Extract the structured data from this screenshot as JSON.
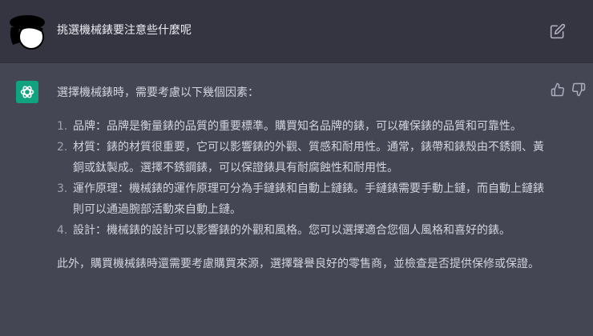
{
  "user_message": {
    "text": "挑選機械錶要注意些什麼呢"
  },
  "assistant_message": {
    "intro": "選擇機械錶時，需要考慮以下幾個因素：",
    "items": [
      {
        "number": "1.",
        "text": "品牌：品牌是衡量錶的品質的重要標準。購買知名品牌的錶，可以確保錶的品質和可靠性。"
      },
      {
        "number": "2.",
        "text": "材質：錶的材質很重要，它可以影響錶的外觀、質感和耐用性。通常，錶帶和錶殼由不銹鋼、黃銅或鈦製成。選擇不銹鋼錶，可以保證錶具有耐腐蝕性和耐用性。"
      },
      {
        "number": "3.",
        "text": "運作原理：機械錶的運作原理可分為手鏈錶和自動上鏈錶。手鏈錶需要手動上鏈，而自動上鏈錶則可以通過腕部活動來自動上鏈。"
      },
      {
        "number": "4.",
        "text": "設計：機械錶的設計可以影響錶的外觀和風格。您可以選擇適合您個人風格和喜好的錶。"
      }
    ],
    "outro": "此外，購買機械錶時還需要考慮購買來源，選擇聲譽良好的零售商，並檢查是否提供保修或保證。"
  },
  "colors": {
    "user_bg": "#343541",
    "assistant_bg": "#444654",
    "accent": "#10a37f",
    "text": "#d1d5db"
  },
  "icons": {
    "user_avatar": "user-avatar-icon",
    "edit": "edit-icon",
    "assistant_logo": "openai-logo-icon",
    "thumbs_up": "thumbs-up-icon",
    "thumbs_down": "thumbs-down-icon"
  }
}
